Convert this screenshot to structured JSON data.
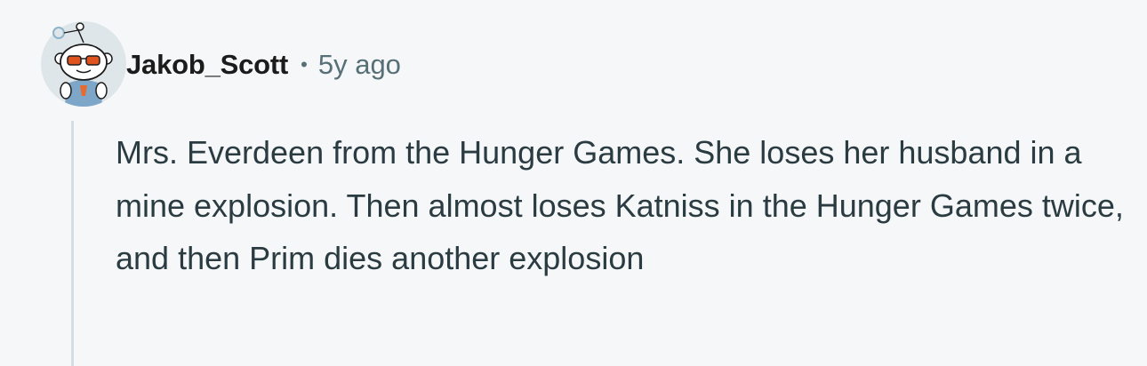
{
  "comment": {
    "author": "Jakob_Scott",
    "separator": "•",
    "timestamp": "5y ago",
    "body": "Mrs. Everdeen from the Hunger Games. She loses her husband in a mine explosion. Then almost loses Katniss in the Hunger Games twice, and then Prim dies another explosion"
  },
  "avatar": {
    "icon": "snoo-avatar-icon",
    "colors": {
      "background": "#dfe6ea",
      "head": "#ffffff",
      "antenna": "#8fb3cb",
      "sunglasses": "#e0531f",
      "body": "#7ea6c8",
      "accent": "#e56b2f"
    }
  },
  "colors": {
    "background": "#f6f7f8",
    "username": "#1c1c1c",
    "meta": "#576f76",
    "text": "#2a3c42",
    "thread_line": "#d5dde2"
  }
}
